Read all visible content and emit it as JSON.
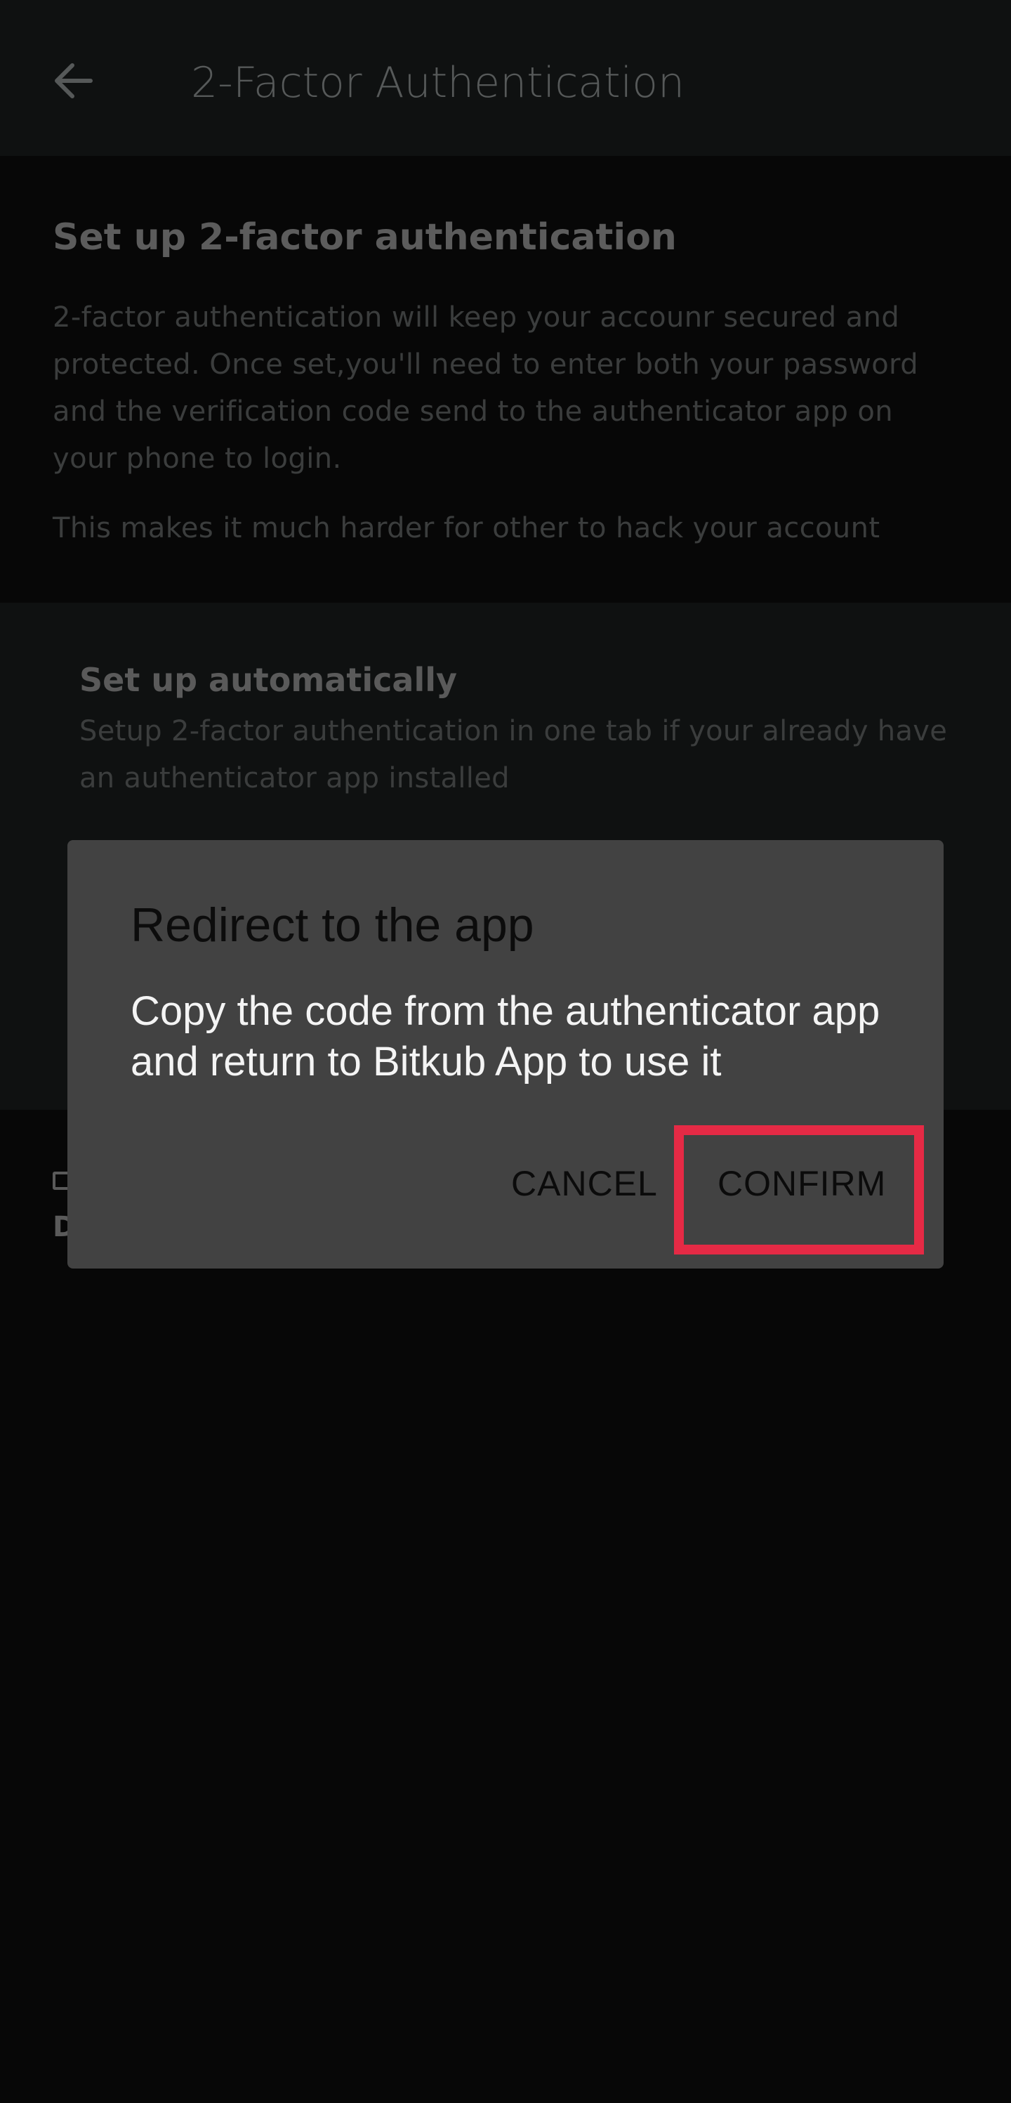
{
  "header": {
    "title": "2-Factor Authentication",
    "back_icon": "arrow-left-icon"
  },
  "intro": {
    "title": "Set up 2-factor authentication",
    "body": "2-factor authentication will keep your accounr secured and protected. Once set,you'll need to enter both your password and the verification code send to the authenticator app on your phone to login.",
    "note": "This makes it much harder for other to hack your account"
  },
  "options": {
    "auto_title": "Set up automatically",
    "auto_description": "Setup 2-factor authentication in one tab if your already have an authenticator app installed"
  },
  "footer": {
    "partial_char": "D"
  },
  "dialog": {
    "title": "Redirect to the app",
    "message": "Copy the code from the authenticator app and return to Bitkub App to use it",
    "cancel_label": "CANCEL",
    "confirm_label": "CONFIRM",
    "highlight_color": "#e52a45"
  }
}
